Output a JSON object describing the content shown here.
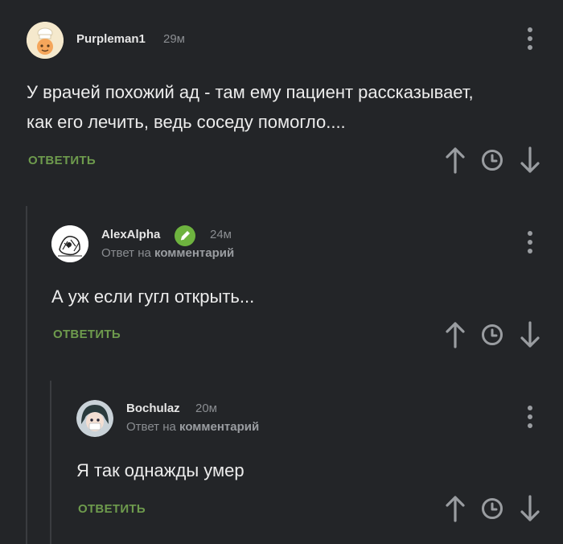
{
  "comments": [
    {
      "author": "Purpleman1",
      "time": "29м",
      "text_lines": [
        "У врачей похожий ад - там ему пациент рассказывает,",
        "как его лечить, ведь соседу помогло...."
      ],
      "reply_label": "ОТВЕТИТЬ"
    },
    {
      "author": "AlexAlpha",
      "time": "24м",
      "reply_to_prefix": "Ответ на",
      "reply_to_link": "комментарий",
      "text": "А уж если гугл открыть...",
      "reply_label": "ОТВЕТИТЬ"
    },
    {
      "author": "Bochulaz",
      "time": "20м",
      "reply_to_prefix": "Ответ на",
      "reply_to_link": "комментарий",
      "text": "Я так однажды умер",
      "reply_label": "ОТВЕТИТЬ"
    }
  ],
  "icons": {
    "upvote": "arrow-up-icon",
    "save": "clock-icon",
    "downvote": "arrow-down-icon",
    "menu": "more-vertical-icon",
    "badge": "pencil-icon"
  },
  "colors": {
    "background": "#232528",
    "reply_green": "#6e9b4d",
    "badge_green": "#6eb33f",
    "muted": "#8a8d91"
  }
}
